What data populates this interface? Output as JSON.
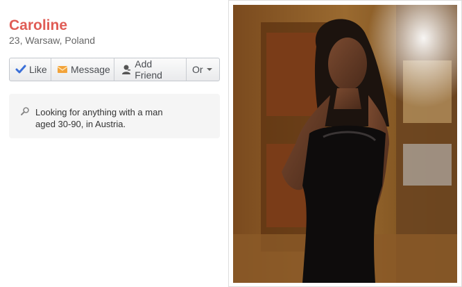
{
  "profile": {
    "name": "Caroline",
    "meta": "23, Warsaw, Poland"
  },
  "actions": {
    "like": "Like",
    "message": "Message",
    "add_friend": "Add Friend",
    "or": "Or"
  },
  "looking_for": {
    "line1": "Looking for anything with a man",
    "line2": "aged 30-90, in Austria."
  },
  "colors": {
    "name": "#e05c55",
    "like_check": "#3a6fd8",
    "message_icon": "#f2a33a"
  },
  "icons": [
    "checkmark-icon",
    "envelope-icon",
    "person-add-icon",
    "chevron-down-icon",
    "magnifier-icon"
  ]
}
